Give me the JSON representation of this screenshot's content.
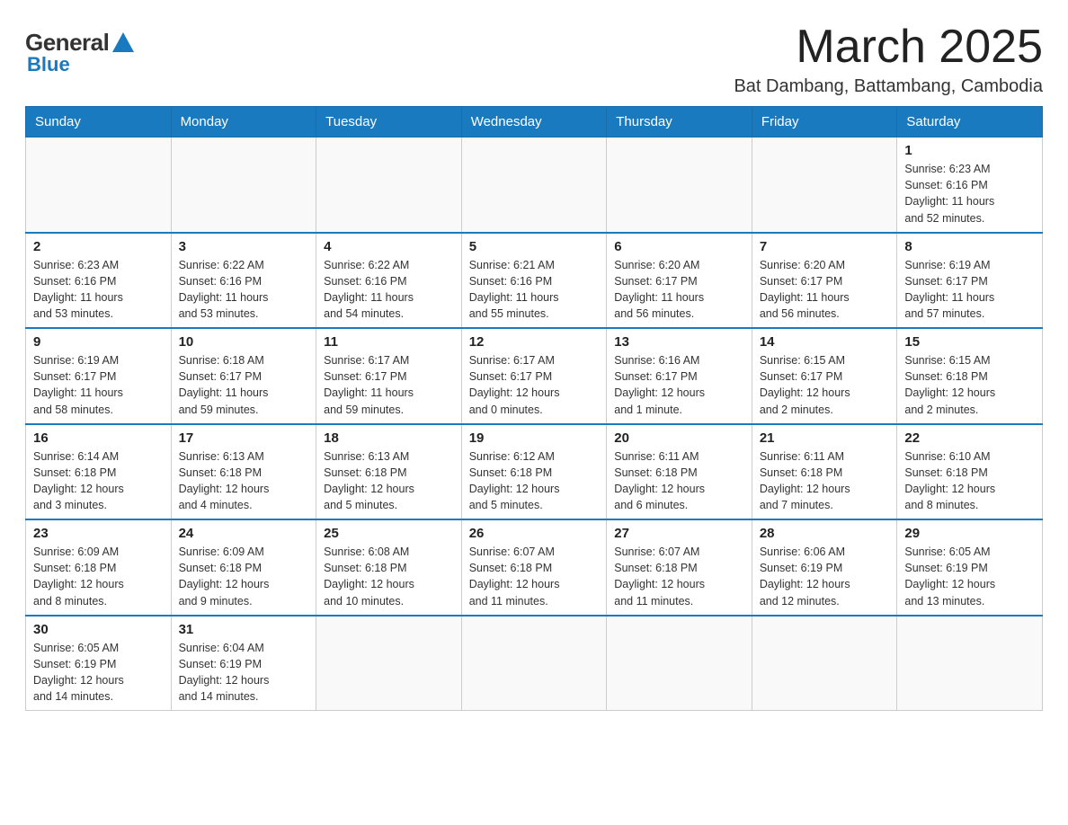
{
  "logo": {
    "general": "General",
    "blue": "Blue",
    "triangle": "▲"
  },
  "header": {
    "month_title": "March 2025",
    "location": "Bat Dambang, Battambang, Cambodia"
  },
  "days_of_week": [
    "Sunday",
    "Monday",
    "Tuesday",
    "Wednesday",
    "Thursday",
    "Friday",
    "Saturday"
  ],
  "weeks": [
    [
      {
        "day": "",
        "info": ""
      },
      {
        "day": "",
        "info": ""
      },
      {
        "day": "",
        "info": ""
      },
      {
        "day": "",
        "info": ""
      },
      {
        "day": "",
        "info": ""
      },
      {
        "day": "",
        "info": ""
      },
      {
        "day": "1",
        "info": "Sunrise: 6:23 AM\nSunset: 6:16 PM\nDaylight: 11 hours\nand 52 minutes."
      }
    ],
    [
      {
        "day": "2",
        "info": "Sunrise: 6:23 AM\nSunset: 6:16 PM\nDaylight: 11 hours\nand 53 minutes."
      },
      {
        "day": "3",
        "info": "Sunrise: 6:22 AM\nSunset: 6:16 PM\nDaylight: 11 hours\nand 53 minutes."
      },
      {
        "day": "4",
        "info": "Sunrise: 6:22 AM\nSunset: 6:16 PM\nDaylight: 11 hours\nand 54 minutes."
      },
      {
        "day": "5",
        "info": "Sunrise: 6:21 AM\nSunset: 6:16 PM\nDaylight: 11 hours\nand 55 minutes."
      },
      {
        "day": "6",
        "info": "Sunrise: 6:20 AM\nSunset: 6:17 PM\nDaylight: 11 hours\nand 56 minutes."
      },
      {
        "day": "7",
        "info": "Sunrise: 6:20 AM\nSunset: 6:17 PM\nDaylight: 11 hours\nand 56 minutes."
      },
      {
        "day": "8",
        "info": "Sunrise: 6:19 AM\nSunset: 6:17 PM\nDaylight: 11 hours\nand 57 minutes."
      }
    ],
    [
      {
        "day": "9",
        "info": "Sunrise: 6:19 AM\nSunset: 6:17 PM\nDaylight: 11 hours\nand 58 minutes."
      },
      {
        "day": "10",
        "info": "Sunrise: 6:18 AM\nSunset: 6:17 PM\nDaylight: 11 hours\nand 59 minutes."
      },
      {
        "day": "11",
        "info": "Sunrise: 6:17 AM\nSunset: 6:17 PM\nDaylight: 11 hours\nand 59 minutes."
      },
      {
        "day": "12",
        "info": "Sunrise: 6:17 AM\nSunset: 6:17 PM\nDaylight: 12 hours\nand 0 minutes."
      },
      {
        "day": "13",
        "info": "Sunrise: 6:16 AM\nSunset: 6:17 PM\nDaylight: 12 hours\nand 1 minute."
      },
      {
        "day": "14",
        "info": "Sunrise: 6:15 AM\nSunset: 6:17 PM\nDaylight: 12 hours\nand 2 minutes."
      },
      {
        "day": "15",
        "info": "Sunrise: 6:15 AM\nSunset: 6:18 PM\nDaylight: 12 hours\nand 2 minutes."
      }
    ],
    [
      {
        "day": "16",
        "info": "Sunrise: 6:14 AM\nSunset: 6:18 PM\nDaylight: 12 hours\nand 3 minutes."
      },
      {
        "day": "17",
        "info": "Sunrise: 6:13 AM\nSunset: 6:18 PM\nDaylight: 12 hours\nand 4 minutes."
      },
      {
        "day": "18",
        "info": "Sunrise: 6:13 AM\nSunset: 6:18 PM\nDaylight: 12 hours\nand 5 minutes."
      },
      {
        "day": "19",
        "info": "Sunrise: 6:12 AM\nSunset: 6:18 PM\nDaylight: 12 hours\nand 5 minutes."
      },
      {
        "day": "20",
        "info": "Sunrise: 6:11 AM\nSunset: 6:18 PM\nDaylight: 12 hours\nand 6 minutes."
      },
      {
        "day": "21",
        "info": "Sunrise: 6:11 AM\nSunset: 6:18 PM\nDaylight: 12 hours\nand 7 minutes."
      },
      {
        "day": "22",
        "info": "Sunrise: 6:10 AM\nSunset: 6:18 PM\nDaylight: 12 hours\nand 8 minutes."
      }
    ],
    [
      {
        "day": "23",
        "info": "Sunrise: 6:09 AM\nSunset: 6:18 PM\nDaylight: 12 hours\nand 8 minutes."
      },
      {
        "day": "24",
        "info": "Sunrise: 6:09 AM\nSunset: 6:18 PM\nDaylight: 12 hours\nand 9 minutes."
      },
      {
        "day": "25",
        "info": "Sunrise: 6:08 AM\nSunset: 6:18 PM\nDaylight: 12 hours\nand 10 minutes."
      },
      {
        "day": "26",
        "info": "Sunrise: 6:07 AM\nSunset: 6:18 PM\nDaylight: 12 hours\nand 11 minutes."
      },
      {
        "day": "27",
        "info": "Sunrise: 6:07 AM\nSunset: 6:18 PM\nDaylight: 12 hours\nand 11 minutes."
      },
      {
        "day": "28",
        "info": "Sunrise: 6:06 AM\nSunset: 6:19 PM\nDaylight: 12 hours\nand 12 minutes."
      },
      {
        "day": "29",
        "info": "Sunrise: 6:05 AM\nSunset: 6:19 PM\nDaylight: 12 hours\nand 13 minutes."
      }
    ],
    [
      {
        "day": "30",
        "info": "Sunrise: 6:05 AM\nSunset: 6:19 PM\nDaylight: 12 hours\nand 14 minutes."
      },
      {
        "day": "31",
        "info": "Sunrise: 6:04 AM\nSunset: 6:19 PM\nDaylight: 12 hours\nand 14 minutes."
      },
      {
        "day": "",
        "info": ""
      },
      {
        "day": "",
        "info": ""
      },
      {
        "day": "",
        "info": ""
      },
      {
        "day": "",
        "info": ""
      },
      {
        "day": "",
        "info": ""
      }
    ]
  ]
}
